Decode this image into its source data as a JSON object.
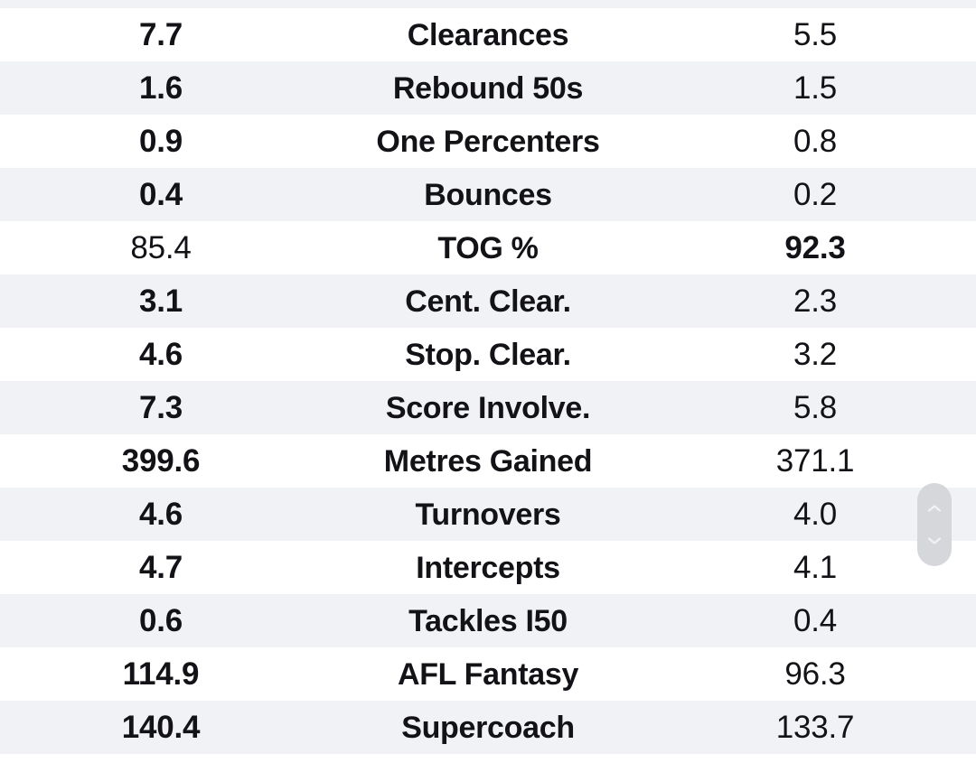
{
  "table": {
    "columns": {
      "left_header": "",
      "label_header": "",
      "right_header": ""
    },
    "rows": [
      {
        "left": "7.7",
        "label": "Clearances",
        "right": "5.5",
        "left_emphasis": "bold",
        "right_emphasis": "normal"
      },
      {
        "left": "1.6",
        "label": "Rebound 50s",
        "right": "1.5",
        "left_emphasis": "bold",
        "right_emphasis": "normal"
      },
      {
        "left": "0.9",
        "label": "One Percenters",
        "right": "0.8",
        "left_emphasis": "bold",
        "right_emphasis": "normal"
      },
      {
        "left": "0.4",
        "label": "Bounces",
        "right": "0.2",
        "left_emphasis": "bold",
        "right_emphasis": "normal"
      },
      {
        "left": "85.4",
        "label": "TOG %",
        "right": "92.3",
        "left_emphasis": "normal",
        "right_emphasis": "bold"
      },
      {
        "left": "3.1",
        "label": "Cent. Clear.",
        "right": "2.3",
        "left_emphasis": "bold",
        "right_emphasis": "normal"
      },
      {
        "left": "4.6",
        "label": "Stop. Clear.",
        "right": "3.2",
        "left_emphasis": "bold",
        "right_emphasis": "normal"
      },
      {
        "left": "7.3",
        "label": "Score Involve.",
        "right": "5.8",
        "left_emphasis": "bold",
        "right_emphasis": "normal"
      },
      {
        "left": "399.6",
        "label": "Metres Gained",
        "right": "371.1",
        "left_emphasis": "bold",
        "right_emphasis": "normal"
      },
      {
        "left": "4.6",
        "label": "Turnovers",
        "right": "4.0",
        "left_emphasis": "bold",
        "right_emphasis": "normal"
      },
      {
        "left": "4.7",
        "label": "Intercepts",
        "right": "4.1",
        "left_emphasis": "bold",
        "right_emphasis": "normal"
      },
      {
        "left": "0.6",
        "label": "Tackles I50",
        "right": "0.4",
        "left_emphasis": "bold",
        "right_emphasis": "normal"
      },
      {
        "left": "114.9",
        "label": "AFL Fantasy",
        "right": "96.3",
        "left_emphasis": "bold",
        "right_emphasis": "normal"
      },
      {
        "left": "140.4",
        "label": "Supercoach",
        "right": "133.7",
        "left_emphasis": "bold",
        "right_emphasis": "normal"
      }
    ]
  },
  "scroll_indicator": {
    "up_icon": "chevron-up-icon",
    "down_icon": "chevron-down-icon"
  },
  "colors": {
    "row_stripe": "#f1f2f6",
    "row_plain": "#ffffff",
    "text": "#121217",
    "scroll_pill": "#d6d7db",
    "scroll_chevron": "#f2f2f4"
  }
}
